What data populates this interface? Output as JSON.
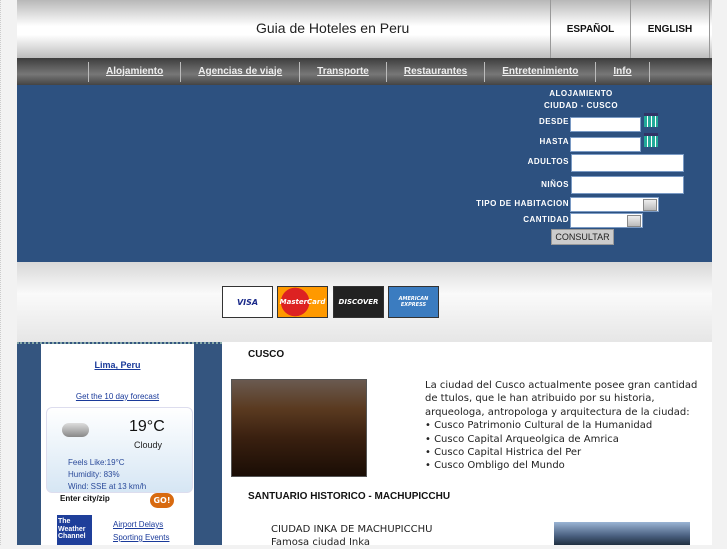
{
  "header": {
    "title": "Guia de Hoteles en Peru",
    "languages": [
      "ESPAÑOL",
      "ENGLISH"
    ]
  },
  "nav": [
    "Alojamiento",
    "Agencias de viaje",
    "Transporte",
    "Restaurantes",
    "Entretenimiento",
    "Info"
  ],
  "form": {
    "heading": "ALOJAMIENTO",
    "city": "CIUDAD - CUSCO",
    "desde": "DESDE",
    "hasta": "HASTA",
    "adultos": "ADULTOS",
    "ninos": "NIÑOS",
    "tipo": "TIPO DE HABITACION",
    "cantidad": "CANTIDAD",
    "submit": "CONSULTAR"
  },
  "cards": [
    "VISA",
    "MasterCard",
    "DISCOVER",
    "AMERICAN EXPRESS"
  ],
  "weather": {
    "city": "Lima, Peru",
    "forecast_link": "Get the 10 day forecast",
    "temp": "19°C",
    "condition": "Cloudy",
    "feels": "Feels Like:19°C",
    "humidity": "Humidity: 83%",
    "wind": "Wind: SSE at 13 km/h",
    "input_label": "Enter city/zip",
    "go": "GO!",
    "brand": "The Weather Channel",
    "links": [
      "Airport Delays",
      "Sporting Events"
    ]
  },
  "main": {
    "cusco_title": "CUSCO",
    "cusco_text": "La ciudad del Cusco actualmente posee gran cantidad de ttulos, que le han atribuido por su historia, arqueologa, antropologa y arquitectura de la ciudad:",
    "cusco_list": [
      "Cusco Patrimonio Cultural de la Humanidad",
      "Cusco Capital Arqueolgica de Amrica",
      "Cusco Capital Histrica del Per",
      "Cusco Ombligo del Mundo"
    ],
    "machu_title": "SANTUARIO HISTORICO - MACHUPICCHU",
    "machu_sub": "CIUDAD INKA DE MACHUPICCHU",
    "machu_text": "Famosa ciudad Inka"
  }
}
